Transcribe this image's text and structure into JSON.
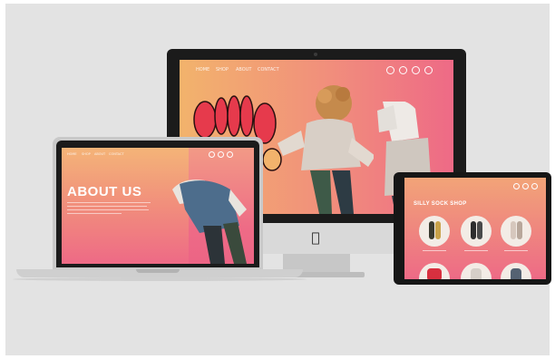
{
  "imac": {
    "nav_links": [
      "HOME",
      "SHOP",
      "ABOUT",
      "CONTACT"
    ],
    "nav_icons": [
      "search-icon",
      "cart-icon",
      "user-icon",
      "menu-icon"
    ]
  },
  "laptop": {
    "heading": "ABOUT US",
    "nav_links": [
      "HOME",
      "SHOP",
      "ABOUT",
      "CONTACT"
    ],
    "nav_icons": [
      "search-icon",
      "cart-icon",
      "user-icon"
    ]
  },
  "tablet": {
    "heading": "SILLY SOCK SHOP",
    "nav_icons": [
      "cart-icon",
      "user-icon",
      "menu-icon"
    ]
  },
  "colors": {
    "backdrop": "#e3e3e3",
    "gradient_orange": "#f2b36c",
    "gradient_pink": "#ee6a86",
    "logo_red": "#e63a4c",
    "device_dark": "#1b1b1b"
  }
}
